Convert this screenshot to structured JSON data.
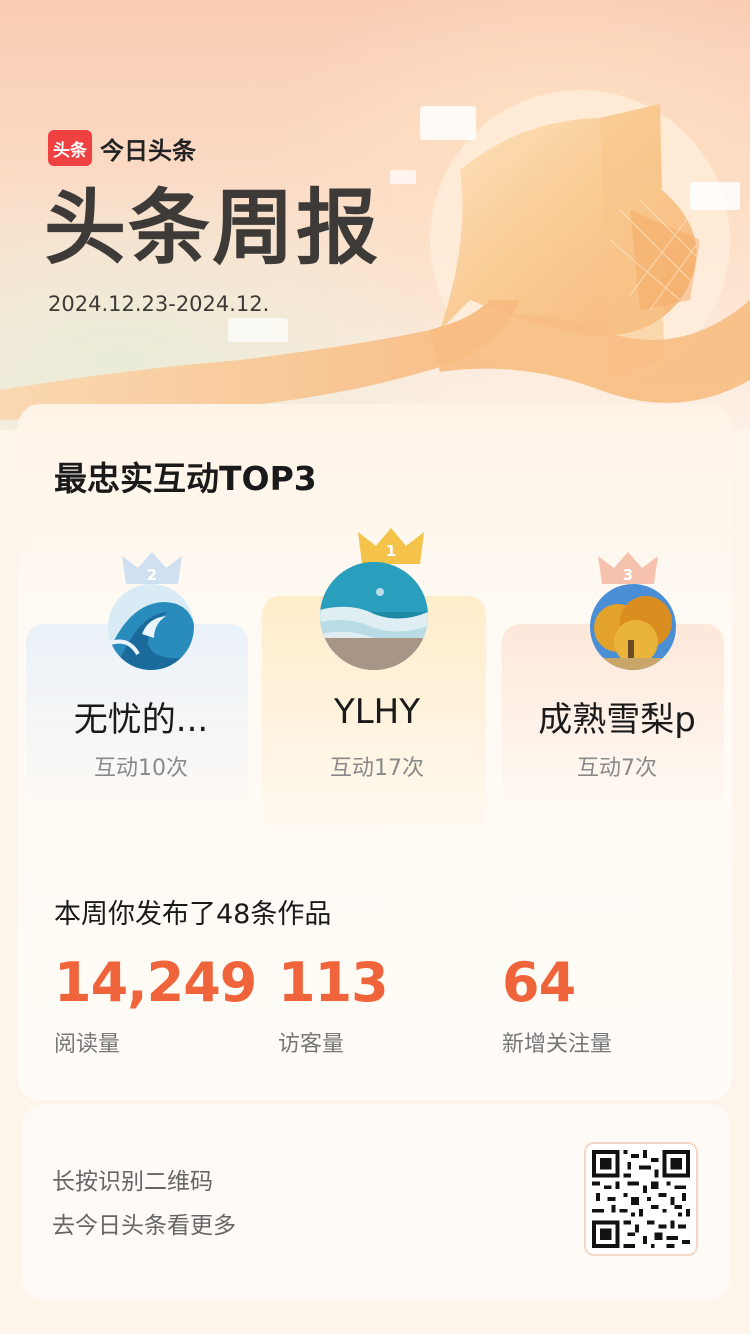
{
  "brand": {
    "badge": "头条",
    "name": "今日头条"
  },
  "page_title": "头条周报",
  "date_range": "2024.12.23-2024.12.",
  "top3": {
    "title": "最忠实互动TOP3",
    "fans": [
      {
        "rank": "2",
        "name": "无忧的...",
        "count": "互动10次",
        "avatar": "wave-avatar"
      },
      {
        "rank": "1",
        "name": "YLHY",
        "count": "互动17次",
        "avatar": "beach-avatar"
      },
      {
        "rank": "3",
        "name": "成熟雪梨p",
        "count": "互动7次",
        "avatar": "autumn-tree-avatar"
      }
    ]
  },
  "works": {
    "title": "本周你发布了48条作品",
    "stats": [
      {
        "value": "14,249",
        "label": "阅读量"
      },
      {
        "value": "113",
        "label": "访客量"
      },
      {
        "value": "64",
        "label": "新增关注量"
      }
    ]
  },
  "footer": {
    "line1": "长按识别二维码",
    "line2": "去今日头条看更多",
    "qr_icon": "qr-code-icon"
  },
  "colors": {
    "accent": "#f0643c",
    "brand_red": "#f04142",
    "crown_gold": "#f5b93e"
  }
}
